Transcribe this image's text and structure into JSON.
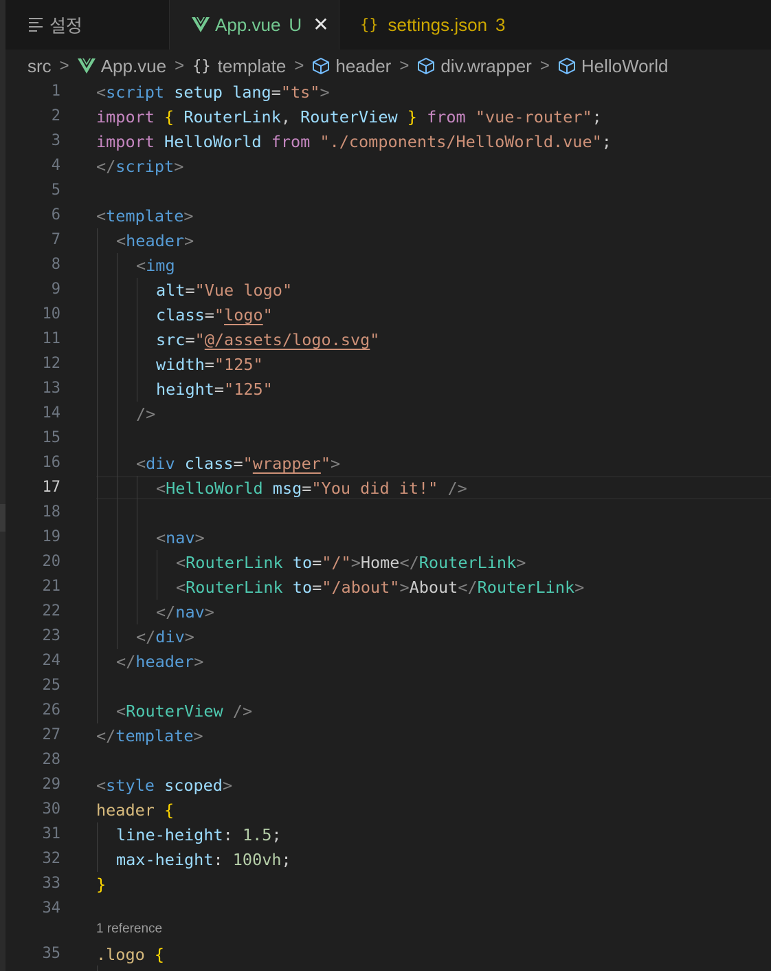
{
  "tabs": {
    "settings": {
      "label": "설정"
    },
    "app": {
      "label": "App.vue",
      "status": "U",
      "close": "✕"
    },
    "json": {
      "braces": "{}",
      "label": "settings.json",
      "count": "3"
    }
  },
  "breadcrumb": {
    "src": "src",
    "file": "App.vue",
    "template_icon": "{}",
    "template": "template",
    "header": "header",
    "wrapper": "div.wrapper",
    "hello": "HelloWorld",
    "separator": ">"
  },
  "editor": {
    "active_line": 17,
    "line_numbers": [
      "1",
      "2",
      "3",
      "4",
      "5",
      "6",
      "7",
      "8",
      "9",
      "10",
      "11",
      "12",
      "13",
      "14",
      "15",
      "16",
      "17",
      "18",
      "19",
      "20",
      "21",
      "22",
      "23",
      "24",
      "25",
      "26",
      "27",
      "28",
      "29",
      "30",
      "31",
      "32",
      "33",
      "34",
      "35"
    ],
    "codelens": "1 reference",
    "code_tokens": {
      "l1": [
        "<",
        "script",
        " ",
        "setup",
        " ",
        "lang",
        "=",
        "\"ts\"",
        ">"
      ],
      "l2": [
        "import",
        " ",
        "{",
        " ",
        "RouterLink",
        ", ",
        "RouterView",
        " ",
        "}",
        " ",
        "from",
        " ",
        "\"vue-router\"",
        ";"
      ],
      "l3": [
        "import",
        " ",
        "HelloWorld",
        " ",
        "from",
        " ",
        "\"./components/HelloWorld.vue\"",
        ";"
      ],
      "l4": [
        "</",
        "script",
        ">"
      ],
      "l6": [
        "<",
        "template",
        ">"
      ],
      "l7": [
        "<",
        "header",
        ">"
      ],
      "l8": [
        "<",
        "img"
      ],
      "l9": [
        "alt",
        "=",
        "\"Vue logo\""
      ],
      "l10": [
        "class",
        "=",
        "\"",
        "logo",
        "\""
      ],
      "l11": [
        "src",
        "=",
        "\"",
        "@/assets/logo.svg",
        "\""
      ],
      "l12": [
        "width",
        "=",
        "\"125\""
      ],
      "l13": [
        "height",
        "=",
        "\"125\""
      ],
      "l14": [
        "/>"
      ],
      "l16": [
        "<",
        "div",
        " ",
        "class",
        "=",
        "\"",
        "wrapper",
        "\"",
        ">"
      ],
      "l17": [
        "<",
        "HelloWorld",
        " ",
        "msg",
        "=",
        "\"You did it!\"",
        " ",
        "/>"
      ],
      "l19": [
        "<",
        "nav",
        ">"
      ],
      "l20": [
        "<",
        "RouterLink",
        " ",
        "to",
        "=",
        "\"/\"",
        ">",
        "Home",
        "</",
        "RouterLink",
        ">"
      ],
      "l21": [
        "<",
        "RouterLink",
        " ",
        "to",
        "=",
        "\"/about\"",
        ">",
        "About",
        "</",
        "RouterLink",
        ">"
      ],
      "l22": [
        "</",
        "nav",
        ">"
      ],
      "l23": [
        "</",
        "div",
        ">"
      ],
      "l24": [
        "</",
        "header",
        ">"
      ],
      "l26": [
        "<",
        "RouterView",
        " ",
        "/>"
      ],
      "l27": [
        "</",
        "template",
        ">"
      ],
      "l29": [
        "<",
        "style",
        " ",
        "scoped",
        ">"
      ],
      "l30": [
        "header",
        " ",
        "{"
      ],
      "l31": [
        "line-height",
        ": ",
        "1.5",
        ";"
      ],
      "l32": [
        "max-height",
        ": ",
        "100vh",
        ";"
      ],
      "l33": [
        "}"
      ],
      "l35": [
        ".logo",
        " ",
        "{"
      ]
    }
  },
  "colors": {
    "background": "#1f1f1f",
    "tag": "#569cd6",
    "attribute": "#9cdcfe",
    "string": "#ce9178",
    "keyword": "#c586c0",
    "component": "#4ec9b0",
    "bracket": "#ffd700",
    "modified_git": "#73c991",
    "warning": "#cca700"
  },
  "icons": {
    "settings_tab": "list-icon",
    "app_tab": "vue-logo-icon",
    "json_tab": "braces-icon",
    "breadcrumb_symbol": "cube-icon"
  }
}
